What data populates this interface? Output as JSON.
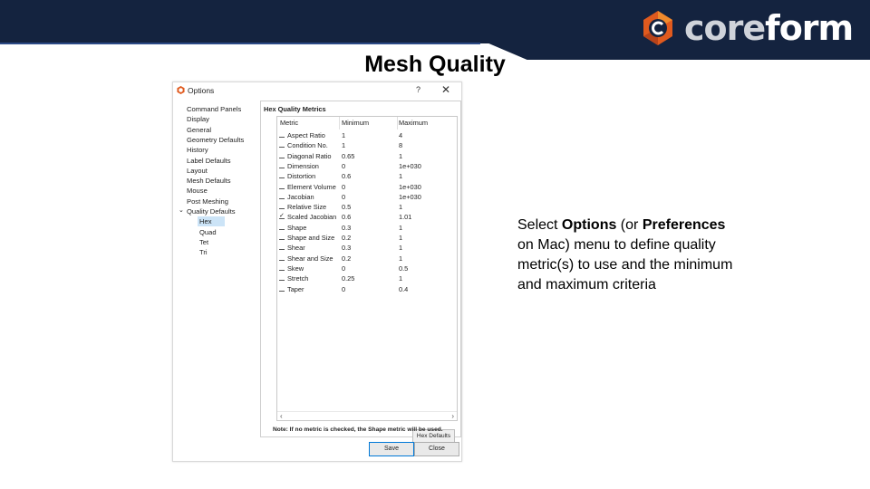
{
  "brand": {
    "logo_text_a": "core",
    "logo_text_b": "form"
  },
  "slide": {
    "title": "Mesh Quality"
  },
  "dialog": {
    "title": "Options",
    "help": "?",
    "close": "✕",
    "tree": [
      {
        "label": "Command Panels"
      },
      {
        "label": "Display"
      },
      {
        "label": "General"
      },
      {
        "label": "Geometry Defaults"
      },
      {
        "label": "History"
      },
      {
        "label": "Label Defaults"
      },
      {
        "label": "Layout"
      },
      {
        "label": "Mesh Defaults"
      },
      {
        "label": "Mouse"
      },
      {
        "label": "Post Meshing"
      },
      {
        "label": "Quality Defaults",
        "expanded": true
      },
      {
        "label": "Hex",
        "child": true,
        "selected": true
      },
      {
        "label": "Quad",
        "child": true
      },
      {
        "label": "Tet",
        "child": true
      },
      {
        "label": "Tri",
        "child": true
      }
    ],
    "panel_title": "Hex Quality Metrics",
    "columns": [
      "Metric",
      "Minimum",
      "Maximum"
    ],
    "rows": [
      {
        "metric": "Aspect Ratio",
        "min": "1",
        "max": "4",
        "checked": false
      },
      {
        "metric": "Condition No.",
        "min": "1",
        "max": "8",
        "checked": false
      },
      {
        "metric": "Diagonal Ratio",
        "min": "0.65",
        "max": "1",
        "checked": false
      },
      {
        "metric": "Dimension",
        "min": "0",
        "max": "1e+030",
        "checked": false
      },
      {
        "metric": "Distortion",
        "min": "0.6",
        "max": "1",
        "checked": false
      },
      {
        "metric": "Element Volume",
        "min": "0",
        "max": "1e+030",
        "checked": false
      },
      {
        "metric": "Jacobian",
        "min": "0",
        "max": "1e+030",
        "checked": false
      },
      {
        "metric": "Relative Size",
        "min": "0.5",
        "max": "1",
        "checked": false
      },
      {
        "metric": "Scaled Jacobian",
        "min": "0.6",
        "max": "1.01",
        "checked": true
      },
      {
        "metric": "Shape",
        "min": "0.3",
        "max": "1",
        "checked": false
      },
      {
        "metric": "Shape and Size",
        "min": "0.2",
        "max": "1",
        "checked": false
      },
      {
        "metric": "Shear",
        "min": "0.3",
        "max": "1",
        "checked": false
      },
      {
        "metric": "Shear and Size",
        "min": "0.2",
        "max": "1",
        "checked": false
      },
      {
        "metric": "Skew",
        "min": "0",
        "max": "0.5",
        "checked": false
      },
      {
        "metric": "Stretch",
        "min": "0.25",
        "max": "1",
        "checked": false
      },
      {
        "metric": "Taper",
        "min": "0",
        "max": "0.4",
        "checked": false
      }
    ],
    "hex_defaults_label": "Hex Defaults",
    "note": "Note: If no metric is checked, the Shape metric will be used.",
    "save_label": "Save",
    "close_label": "Close"
  },
  "description": {
    "part1": "Select ",
    "bold1": "Options",
    "part2": " (or ",
    "bold2": "Preferences",
    "part3": " on Mac) menu to define quality metric(s) to use and the minimum and maximum criteria"
  },
  "colors": {
    "header": "#14233f",
    "accent": "#2c4a86",
    "selection": "#cce4f7",
    "logo_orange": "#e05a1e"
  }
}
